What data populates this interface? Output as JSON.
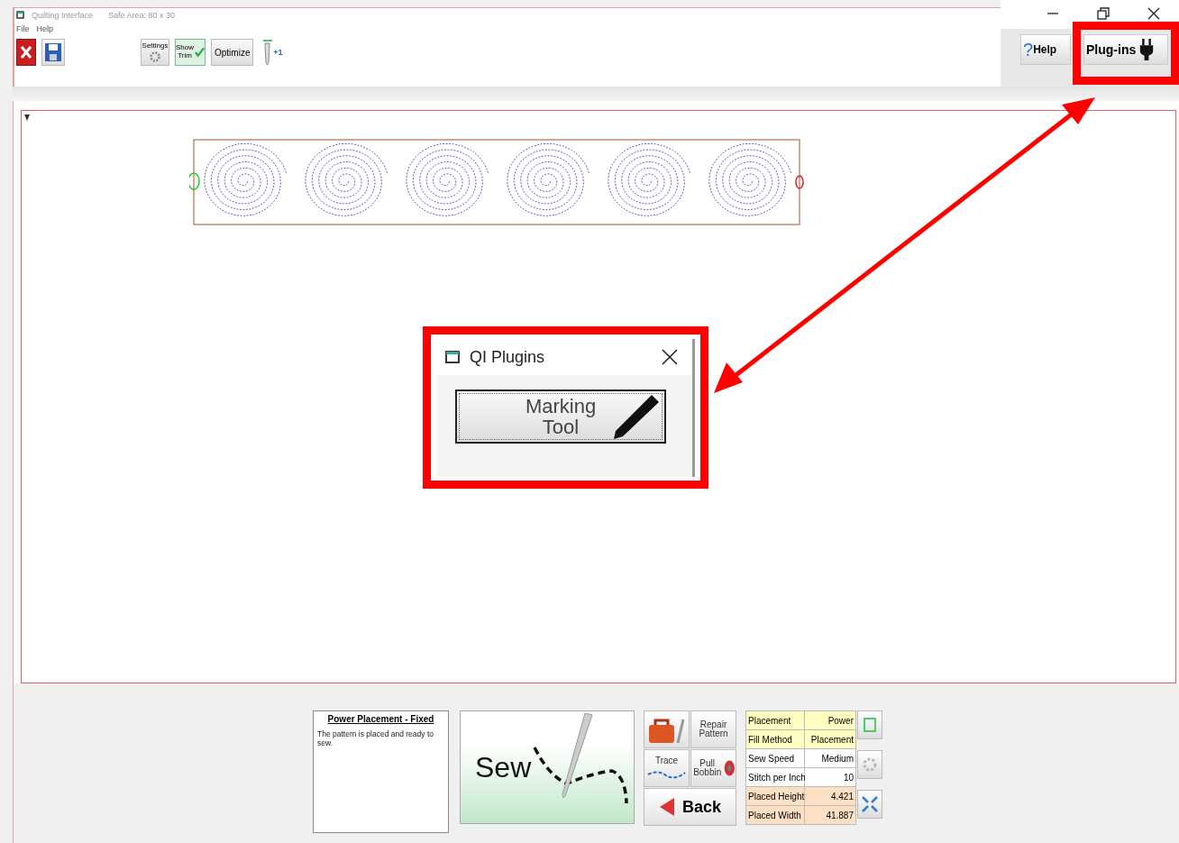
{
  "window": {
    "title": "Quilting Interface",
    "subtitle": "Safe Area: 80 x 30"
  },
  "menu": [
    "File",
    "Help"
  ],
  "toolbar": [
    {
      "kind": "close"
    },
    {
      "kind": "save"
    },
    {
      "kind": "settings",
      "label": "Settings"
    },
    {
      "kind": "toggle",
      "label": "Show Trim",
      "checked": true
    },
    {
      "kind": "text",
      "label": "Optimize"
    },
    {
      "kind": "needle",
      "label": "+1"
    }
  ],
  "right_buttons": [
    {
      "kind": "help",
      "icon": "?",
      "label": "Help"
    },
    {
      "kind": "plugins",
      "label": "Plug-ins"
    }
  ],
  "dialog": {
    "title": "QI Plugins",
    "button": "Marking Tool"
  },
  "info": {
    "heading": "Power Placement - Fixed",
    "text": "The pattern is placed and ready to sew."
  },
  "sew_button": "Sew",
  "tools": [
    {
      "kind": "toolbox"
    },
    {
      "kind": "repair",
      "label": "Repair Pattern"
    },
    {
      "kind": "trace",
      "label": "Trace"
    },
    {
      "kind": "bobbin",
      "label": "Pull Bobbin"
    },
    {
      "kind": "back",
      "label": "Back"
    }
  ],
  "settings": [
    {
      "label": "Placement",
      "value": "Power",
      "color": "#ffffc0"
    },
    {
      "label": "Fill Method",
      "value": "Placement",
      "color": "#ffffc0"
    },
    {
      "label": "Sew Speed",
      "value": "Medium",
      "color": "#ffffff"
    },
    {
      "label": "Stitch per Inch",
      "value": "10",
      "color": "#ffffff"
    },
    {
      "label": "Placed Height",
      "value": "4.421",
      "color": "#fde0c4"
    },
    {
      "label": "Placed Width",
      "value": "41.887",
      "color": "#fde0c4"
    }
  ]
}
